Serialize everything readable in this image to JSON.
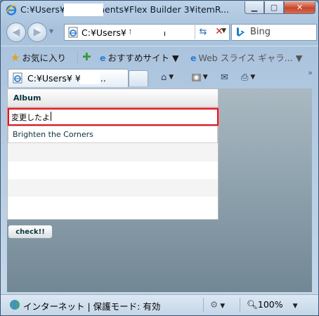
{
  "window": {
    "title": "C:¥Users¥         ¥Documents¥Flex Builder 3¥itemR..."
  },
  "nav": {
    "address": "C:¥Users¥          ¥Docum",
    "search_placeholder": "Bing"
  },
  "favorites": {
    "label": "お気に入り",
    "items": [
      {
        "label": "おすすめサイト ▼"
      },
      {
        "label": "Web スライス ギャラ... ▼"
      }
    ]
  },
  "tab": {
    "title": "C:¥Users¥          ¥Doc..."
  },
  "app": {
    "grid": {
      "column_header": "Album",
      "editor_value": "変更したよ",
      "rows": [
        "Brighten the Corners",
        "",
        "",
        "",
        ""
      ]
    },
    "check_button": "check!!"
  },
  "status": {
    "zone": "インターネット | 保護モード: 有効",
    "zoom": "100%"
  },
  "colors": {
    "accent_red": "#e0161f",
    "row_alt": "#f4f4f4",
    "chrome_blue": "#bcd2e8"
  }
}
